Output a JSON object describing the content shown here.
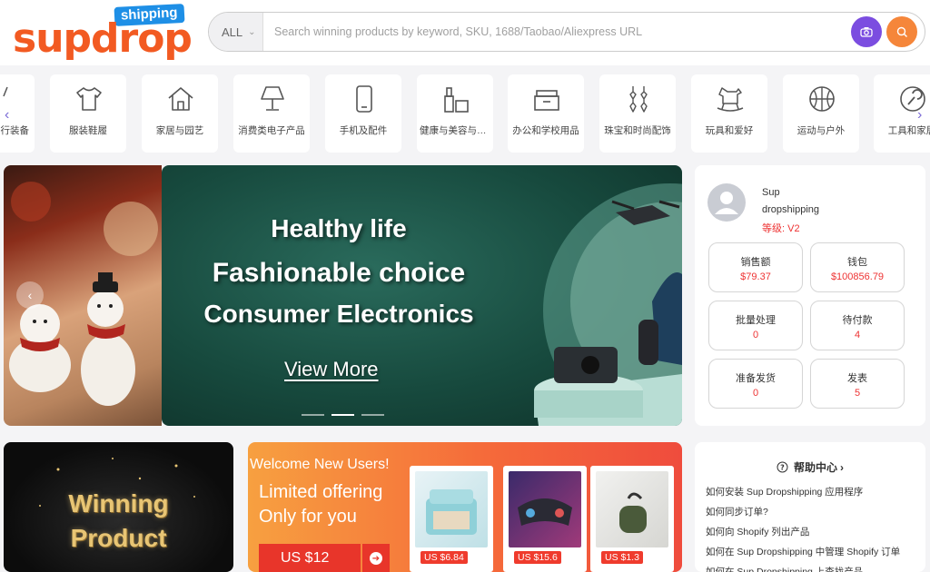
{
  "header": {
    "logo_text": "supdrop",
    "logo_badge": "shipping",
    "search_scope": "ALL",
    "search_placeholder": "Search winning products by keyword, SKU, 1688/Taobao/Aliexpress URL"
  },
  "categories": [
    {
      "label": "行装备",
      "icon": "partial-icon"
    },
    {
      "label": "服装鞋履",
      "icon": "tshirt-icon"
    },
    {
      "label": "家居与园艺",
      "icon": "house-icon"
    },
    {
      "label": "消费类电子产品",
      "icon": "lamp-icon"
    },
    {
      "label": "手机及配件",
      "icon": "phone-icon"
    },
    {
      "label": "健康与美容与个...",
      "icon": "cosmetics-icon"
    },
    {
      "label": "办公和学校用品",
      "icon": "box-icon"
    },
    {
      "label": "珠宝和时尚配饰",
      "icon": "earrings-icon"
    },
    {
      "label": "玩具和爱好",
      "icon": "rocking-horse-icon"
    },
    {
      "label": "运动与户外",
      "icon": "basketball-icon"
    },
    {
      "label": "工具和家居",
      "icon": "wrench-icon"
    }
  ],
  "banner": {
    "line1": "Healthy life",
    "line2": "Fashionable choice",
    "line3": "Consumer Electronics",
    "cta": "View More",
    "active_slide": 2,
    "slide_count": 3
  },
  "user": {
    "name_line1": "Sup",
    "name_line2": "dropshipping",
    "level": "等级: V2",
    "stats": [
      {
        "label": "销售额",
        "value": "$79.37"
      },
      {
        "label": "钱包",
        "value": "$100856.79"
      },
      {
        "label": "批量处理",
        "value": "0"
      },
      {
        "label": "待付款",
        "value": "4"
      },
      {
        "label": "准备发货",
        "value": "0"
      },
      {
        "label": "发表",
        "value": "5"
      }
    ]
  },
  "winning": {
    "line1": "Winning",
    "line2": "Product"
  },
  "welcome": {
    "title": "Welcome New Users!",
    "sub1": "Limited offering",
    "sub2": "Only for you",
    "price": "US $12",
    "products": [
      {
        "price": "US $6.84"
      },
      {
        "price": "US $15.6"
      },
      {
        "price": "US $1.3"
      }
    ]
  },
  "help": {
    "title": "帮助中心",
    "items": [
      "如何安装 Sup Dropshipping 应用程序",
      "如何同步订单?",
      "如何向 Shopify 列出产品",
      "如何在 Sup Dropshipping 中管理 Shopify 订单",
      "如何在 Sup Dropshipping 上查找产品"
    ]
  },
  "colors": {
    "brand_orange": "#f25a22",
    "badge_blue": "#1e8fe6",
    "accent_red": "#e33333",
    "camera_purple": "#7b4de0"
  }
}
